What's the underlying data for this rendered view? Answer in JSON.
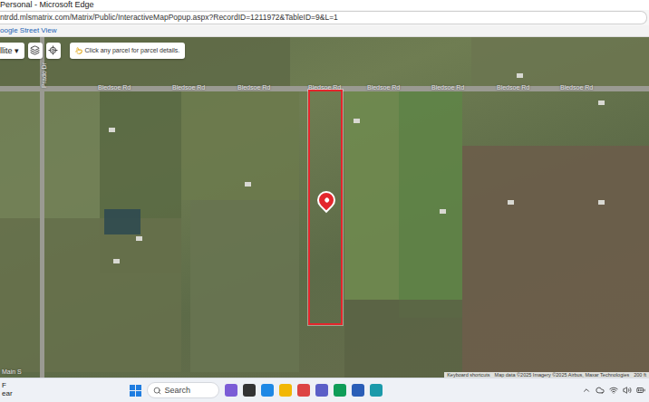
{
  "window": {
    "title": "Personal - Microsoft Edge"
  },
  "address": {
    "url": "ntrdd.mlsmatrix.com/Matrix/Public/InteractiveMapPopup.aspx?RecordID=1211972&TableID=9&L=1"
  },
  "link": "oogle Street View",
  "map": {
    "type_selector": "llite",
    "hint": "Click any parcel for parcel details.",
    "roads": [
      {
        "label": "Prado Dr",
        "kind": "vertical"
      },
      {
        "label": "Bledsoe Rd",
        "kind": "horizontal"
      },
      {
        "label": "Bledsoe Rd",
        "kind": "horizontal"
      },
      {
        "label": "Bledsoe Rd",
        "kind": "horizontal"
      },
      {
        "label": "Bledsoe Rd",
        "kind": "horizontal"
      },
      {
        "label": "Bledsoe Rd",
        "kind": "horizontal"
      },
      {
        "label": "Bledsoe Rd",
        "kind": "horizontal"
      },
      {
        "label": "Bledsoe Rd",
        "kind": "horizontal"
      },
      {
        "label": "Bledsoe Rd",
        "kind": "horizontal"
      },
      {
        "label": "Main S",
        "kind": "horizontal"
      }
    ],
    "footer": [
      "Keyboard shortcuts",
      "Map data ©2025 Imagery ©2025 Airbus, Maxar Technologies",
      "200 ft"
    ]
  },
  "taskbar": {
    "weather": [
      "F",
      "ear"
    ],
    "search": "Search"
  }
}
